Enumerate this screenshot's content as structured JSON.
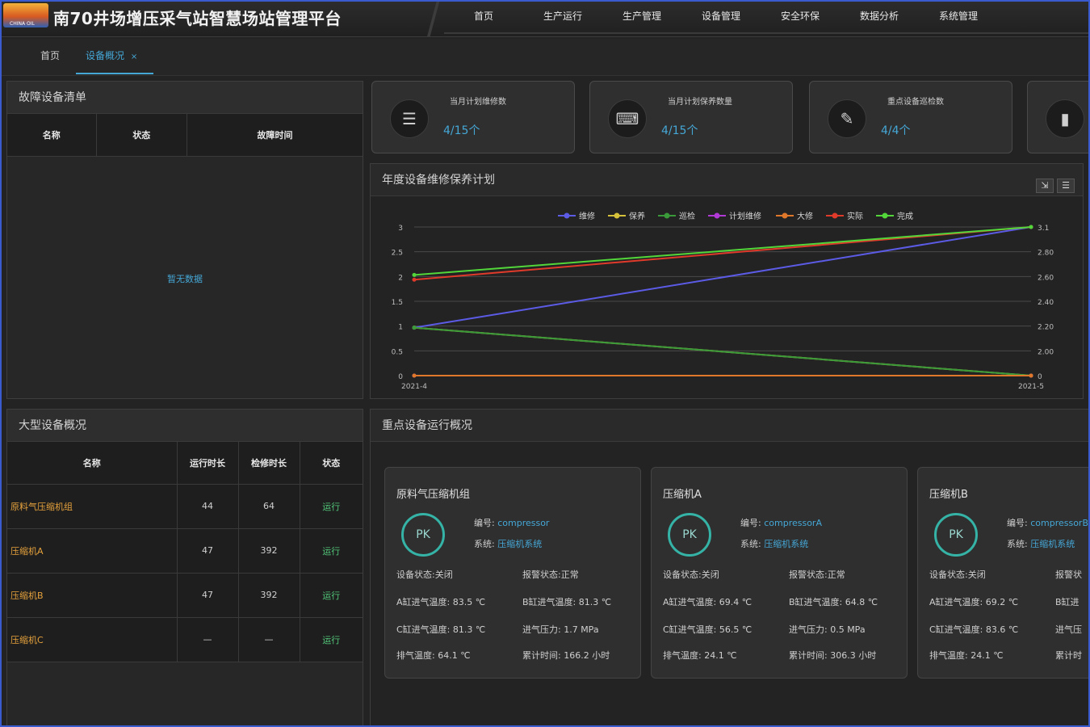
{
  "header": {
    "logo_text": "CHINA OIL",
    "title": "南70井场增压采气站智慧场站管理平台",
    "nav": [
      "首页",
      "生产运行",
      "生产管理",
      "设备管理",
      "安全环保",
      "数据分析",
      "系统管理"
    ]
  },
  "tabs": [
    {
      "label": "首页"
    },
    {
      "label": "设备概况",
      "close": "×"
    }
  ],
  "fault_panel": {
    "title": "故障设备清单",
    "headers": [
      "名称",
      "状态",
      "故障时间"
    ],
    "empty_text": "暂无数据"
  },
  "stats": [
    {
      "label": "当月计划维修数",
      "value": "4/15个",
      "icon": "☰"
    },
    {
      "label": "当月计划保养数量",
      "value": "4/15个",
      "icon": "⌨"
    },
    {
      "label": "重点设备巡检数",
      "value": "4/4个",
      "icon": "✎"
    },
    {
      "label": "",
      "value": "",
      "icon": "▮"
    }
  ],
  "chart_panel": {
    "title": "年度设备维修保养计划",
    "tools": [
      "⇲",
      "☰"
    ]
  },
  "chart_data": {
    "type": "line",
    "x": [
      "2021-4",
      "2021-5"
    ],
    "series": [
      {
        "name": "维修",
        "color": "#5b5be6",
        "values": [
          1,
          3.1
        ]
      },
      {
        "name": "保养",
        "color": "#d6c23a",
        "values": [
          1,
          0
        ]
      },
      {
        "name": "巡检",
        "color": "#3a9a3a",
        "values": [
          1,
          0
        ]
      },
      {
        "name": "计划维修",
        "color": "#b13ad6",
        "values": [
          0,
          0
        ]
      },
      {
        "name": "大修",
        "color": "#e0782b",
        "values": [
          0,
          0
        ]
      },
      {
        "name": "实际",
        "color": "#e03a2b",
        "values": [
          2,
          3.1
        ]
      },
      {
        "name": "完成",
        "color": "#52d63a",
        "values": [
          2.1,
          3.1
        ]
      }
    ],
    "yleft_ticks": [
      "0",
      "0.5",
      "1",
      "1.5",
      "2",
      "2.5",
      "3"
    ],
    "yright_ticks": [
      "0",
      "2.00",
      "2.20",
      "2.40",
      "2.60",
      "2.80",
      "3.1"
    ],
    "ylim": [
      0,
      3.1
    ]
  },
  "large_panel": {
    "title": "大型设备概况",
    "headers": [
      "名称",
      "运行时长",
      "检修时长",
      "状态"
    ],
    "rows": [
      {
        "name": "原料气压缩机组",
        "run": "44",
        "repair": "64",
        "status": "运行"
      },
      {
        "name": "压缩机A",
        "run": "47",
        "repair": "392",
        "status": "运行"
      },
      {
        "name": "压缩机B",
        "run": "47",
        "repair": "392",
        "status": "运行"
      },
      {
        "name": "压缩机C",
        "run": "—",
        "repair": "—",
        "status": "运行"
      }
    ]
  },
  "key_panel": {
    "title": "重点设备运行概况",
    "cards": [
      {
        "name": "原料气压缩机组",
        "ring": "PK",
        "code_label": "编号:",
        "code": "compressor",
        "type_label": "系统:",
        "type": "压缩机系统",
        "f1": "设备状态:关闭",
        "f2": "报警状态:正常",
        "f3": "A缸进气温度: 83.5 ℃",
        "f4": "B缸进气温度: 81.3 ℃",
        "f5": "C缸进气温度: 81.3 ℃",
        "f6": "进气压力: 1.7 MPa",
        "f7": "排气温度: 64.1 ℃",
        "f8": "累计时间: 166.2 小时"
      },
      {
        "name": "压缩机A",
        "ring": "PK",
        "code_label": "编号:",
        "code": "compressorA",
        "type_label": "系统:",
        "type": "压缩机系统",
        "f1": "设备状态:关闭",
        "f2": "报警状态:正常",
        "f3": "A缸进气温度: 69.4 ℃",
        "f4": "B缸进气温度: 64.8 ℃",
        "f5": "C缸进气温度: 56.5 ℃",
        "f6": "进气压力: 0.5 MPa",
        "f7": "排气温度: 24.1 ℃",
        "f8": "累计时间: 306.3 小时"
      },
      {
        "name": "压缩机B",
        "ring": "PK",
        "code_label": "编号:",
        "code": "compressorB",
        "type_label": "系统:",
        "type": "压缩机系统",
        "f1": "设备状态:关闭",
        "f2": "报警状",
        "f3": "A缸进气温度: 69.2 ℃",
        "f4": "B缸进",
        "f5": "C缸进气温度: 83.6 ℃",
        "f6": "进气压",
        "f7": "排气温度: 24.1 ℃",
        "f8": "累计时"
      }
    ]
  }
}
